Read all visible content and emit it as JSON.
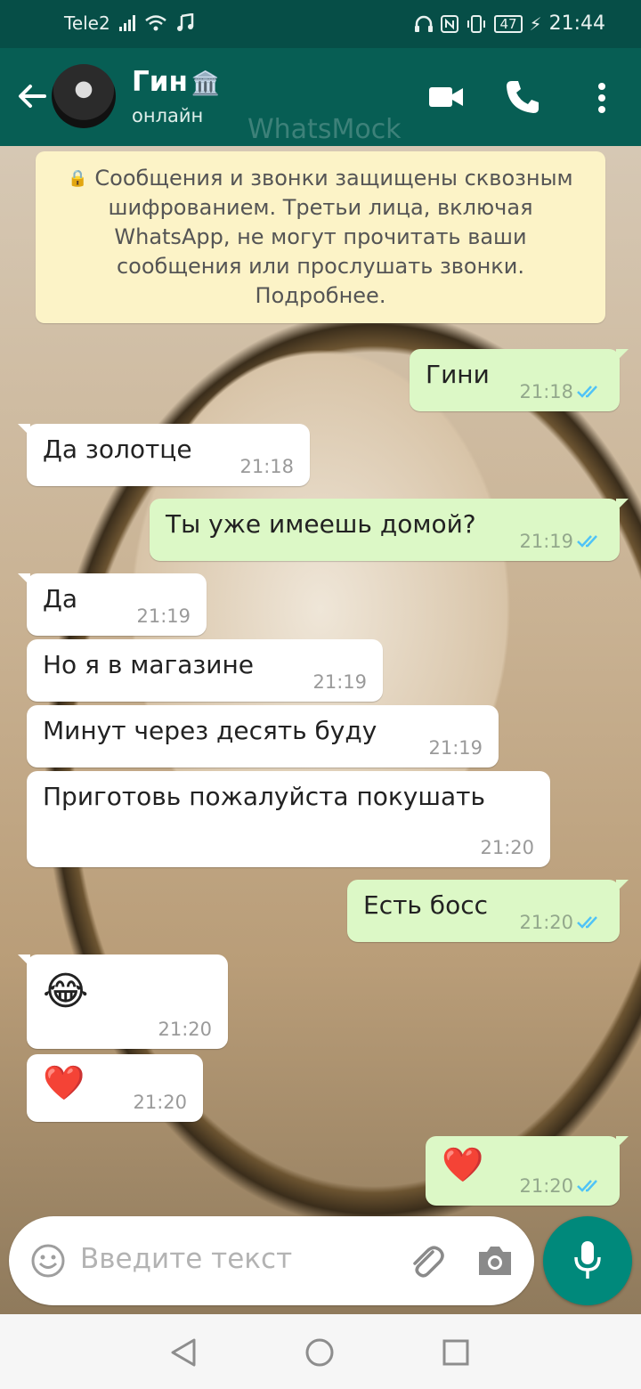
{
  "status_bar": {
    "carrier": "Tele2",
    "battery": "47",
    "time": "21:44"
  },
  "header": {
    "name": "Гин",
    "status": "онлайн",
    "watermark": "WhatsMock"
  },
  "encryption_notice": "Сообщения и звонки защищены сквозным шифрованием. Третьи лица, включая WhatsApp, не могут прочитать ваши сообщения или прослушать звонки. Подробнее.",
  "messages": [
    {
      "dir": "out",
      "text": "Гини",
      "time": "21:18"
    },
    {
      "dir": "in",
      "text": "Да золотце",
      "time": "21:18"
    },
    {
      "dir": "out",
      "text": "Ты уже имеешь домой?",
      "time": "21:19"
    },
    {
      "dir": "in",
      "text": "Да",
      "time": "21:19"
    },
    {
      "dir": "in",
      "text": "Но я в магазине",
      "time": "21:19"
    },
    {
      "dir": "in",
      "text": "Минут через десять буду",
      "time": "21:19"
    },
    {
      "dir": "in",
      "text": "Приготовь пожалуйста покушать",
      "time": "21:20"
    },
    {
      "dir": "out",
      "text": "Есть босс",
      "time": "21:20"
    },
    {
      "dir": "in",
      "text": "😂",
      "time": "21:20"
    },
    {
      "dir": "in",
      "text": "❤️",
      "time": "21:20"
    },
    {
      "dir": "out",
      "text": "❤️",
      "time": "21:20"
    }
  ],
  "input": {
    "placeholder": "Введите текст"
  },
  "icons": {
    "back": "arrow-left-icon",
    "video": "video-call-icon",
    "call": "phone-icon",
    "menu": "more-vert-icon",
    "emoji": "emoji-icon",
    "attach": "paperclip-icon",
    "camera": "camera-icon",
    "mic": "microphone-icon",
    "nav_back": "nav-back-icon",
    "nav_home": "nav-home-icon",
    "nav_recents": "nav-recents-icon"
  },
  "colors": {
    "header": "#075e54",
    "status_bar": "#064e47",
    "outgoing": "#dcf8c6",
    "incoming": "#ffffff",
    "read_ticks": "#4fc3f7",
    "mic_button": "#00897b"
  }
}
